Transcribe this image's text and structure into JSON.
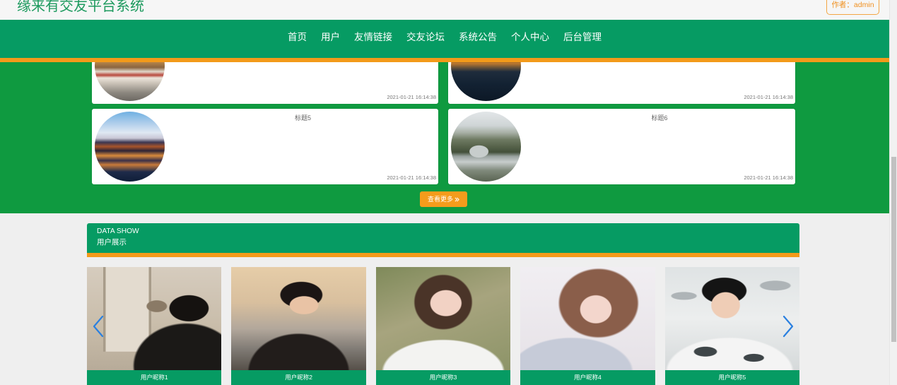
{
  "colors": {
    "primary": "#069b63",
    "accent": "#f39a1a",
    "news_bg": "#0f9a40",
    "arrow": "#2a80e0"
  },
  "header": {
    "title": "缘来有交友平台系统",
    "author": "作者：admin"
  },
  "nav": {
    "items": [
      "首页",
      "用户",
      "友情链接",
      "交友论坛",
      "系统公告",
      "个人中心",
      "后台管理"
    ]
  },
  "news": {
    "cards": [
      {
        "time": "2021-01-21 16:14:38"
      },
      {
        "time": "2021-01-21 16:14:38"
      },
      {
        "title": "标题5",
        "time": "2021-01-21 16:14:38"
      },
      {
        "title": "标题6",
        "time": "2021-01-21 16:14:38"
      }
    ],
    "more_label": "查看更多",
    "more_icon": "double-chevron-right-icon"
  },
  "user_show": {
    "heading_en": "DATA SHOW",
    "heading": "用户展示",
    "prev_icon": "chevron-left-icon",
    "next_icon": "chevron-right-icon",
    "users": [
      {
        "nickname": "用户昵称1"
      },
      {
        "nickname": "用户昵称2"
      },
      {
        "nickname": "用户昵称3"
      },
      {
        "nickname": "用户昵称4"
      },
      {
        "nickname": "用户昵称5"
      }
    ]
  }
}
